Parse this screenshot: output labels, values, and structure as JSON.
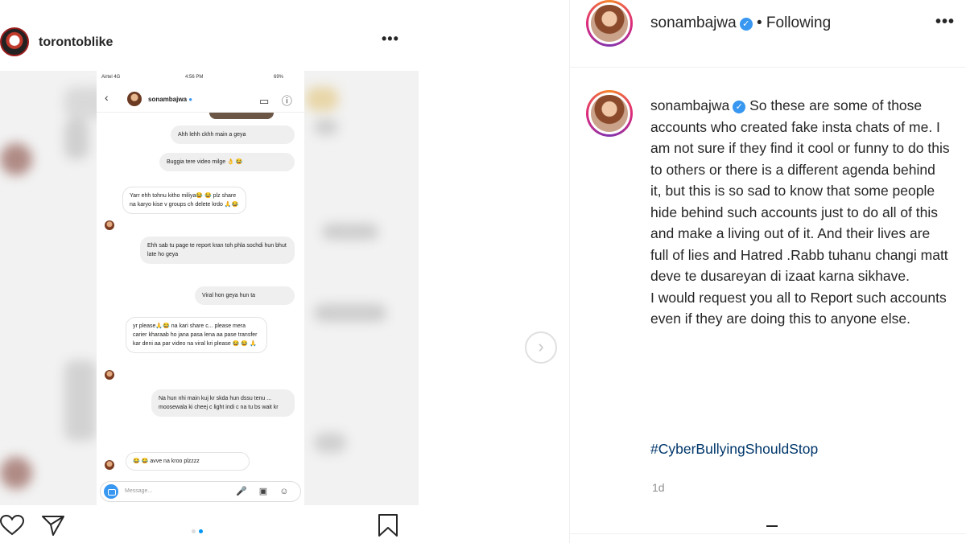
{
  "left_post": {
    "username": "torontoblike",
    "more": "•••",
    "carousel": {
      "slide_count": 2,
      "active_index": 1
    }
  },
  "screenshot": {
    "status": {
      "carrier": "Airtel 4G",
      "time": "4:56 PM",
      "battery": "69%"
    },
    "chat_name": "sonambajwa",
    "messages": [
      {
        "text": "Ahh lehh ckhh main a geya"
      },
      {
        "text": "Buggia tere video milge 👌 😂"
      },
      {
        "text": "Yarr ehh tohnu kitho miliya😂 😂 plz share na karyo kise v groups ch delete krdo 🙏😂"
      },
      {
        "text": "Ehh sab tu page te report kran toh phla sochdi hun bhut late ho geya"
      },
      {
        "text": "Viral hon geya hun ta"
      },
      {
        "text": "yr please🙏😂 na kari share c... please mera carier kharaab ho jana pasa lena aa pase transfer kar deni aa par video na viral kri please 😂 😂 🙏"
      },
      {
        "text": "Na hun nhi main kuj kr skda hun dssu tenu ... moosewala ki cheej c light indi c na tu bs wait kr"
      },
      {
        "text": "😂 😂 avve na kroo plzzzz"
      }
    ],
    "compose_placeholder": "Message..."
  },
  "right_panel": {
    "username": "sonambajwa",
    "verified_glyph": "✓",
    "separator": "•",
    "follow_status": "Following",
    "more": "•••",
    "caption_username": "sonambajwa",
    "caption_text": "So these are some of those accounts who created fake insta chats of me. I am not sure if they find it cool or funny to do this to others or there is a different agenda behind it, but this is so sad to know that some people hide behind such accounts just to do all of this and make a living out of it. And their lives are full of lies and Hatred .Rabb tuhanu changi matt deve te dusareyan di izaat karna sikhave.",
    "caption_text_2": "I would request you all to Report such accounts even if they are doing this to anyone else.",
    "hashtag": "#CyberBullyingShouldStop",
    "time": "1d"
  },
  "icons": {
    "next": "›",
    "back": "‹",
    "chat_actions": "▭ ⓘ",
    "compose_actions": "🎤 ▣ ☺"
  }
}
